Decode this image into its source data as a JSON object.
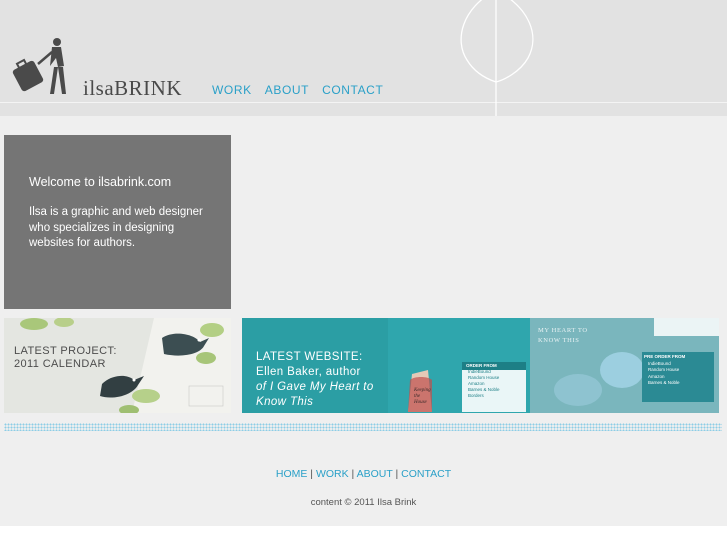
{
  "header": {
    "logo_text": "ilsaBRINK",
    "nav": [
      "WORK",
      "ABOUT",
      "CONTACT"
    ]
  },
  "welcome": {
    "title": "Welcome to ilsabrink.com",
    "body": "Ilsa is a graphic and web designer who specializes in designing websites for authors."
  },
  "cards": {
    "calendar": {
      "line1": "LATEST PROJECT:",
      "line2": "2011 CALENDAR"
    },
    "website": {
      "line1": "LATEST WEBSITE:",
      "line2": "Ellen Baker, author",
      "line3": "of I Gave My Heart to",
      "line4": "Know This",
      "order_heading": "ORDER FROM",
      "order_items": [
        "IndieBound",
        "Random House",
        "Amazon",
        "Barnes & Noble",
        "Borders"
      ],
      "preorder_heading": "PRE ORDER FROM",
      "preorder_items": [
        "IndieBound",
        "Random House",
        "Amazon",
        "Barnes & Noble"
      ],
      "book_title": "Keeping the House",
      "book2_title": "MY HEART TO KNOW THIS"
    }
  },
  "footer": {
    "links": [
      "HOME",
      "WORK",
      "ABOUT",
      "CONTACT"
    ],
    "separator": "|",
    "copyright": "content © 2011 Ilsa Brink"
  },
  "colors": {
    "accent": "#2aa0c8",
    "header_bg": "#e2e2e2",
    "panel_bg": "#757575",
    "teal": "#2e9aa3"
  }
}
